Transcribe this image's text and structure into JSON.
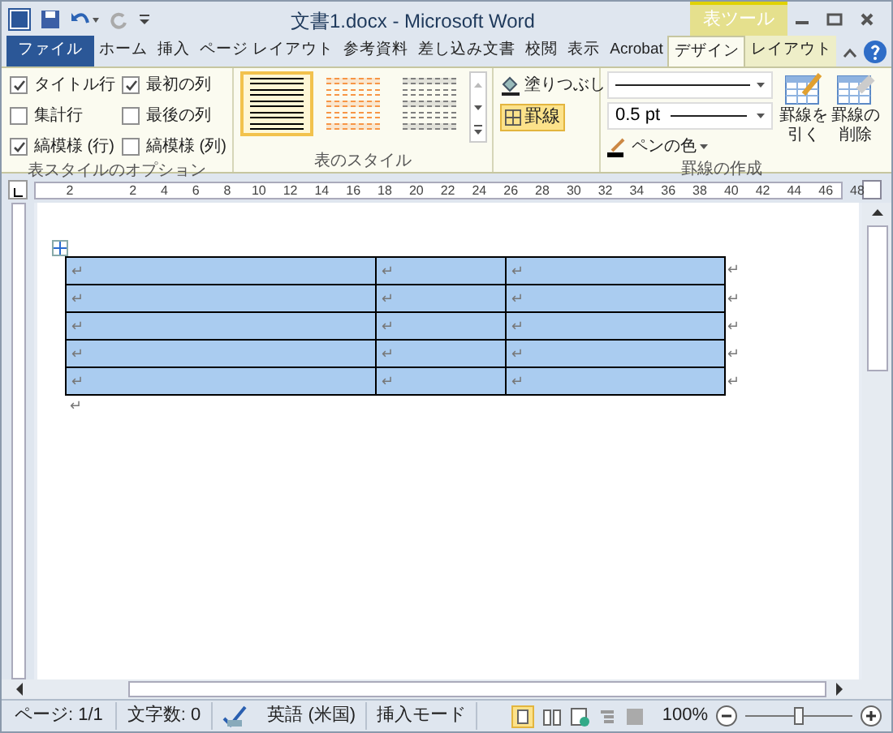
{
  "title_bar": {
    "title": "文書1.docx - Microsoft Word",
    "context_label": "表ツール"
  },
  "tabs": [
    {
      "label": "ファイル",
      "kind": "file",
      "selected": false
    },
    {
      "label": "ホーム",
      "kind": "normal",
      "selected": false
    },
    {
      "label": "挿入",
      "kind": "normal",
      "selected": false
    },
    {
      "label": "ページ レイアウト",
      "kind": "normal",
      "selected": false
    },
    {
      "label": "参考資料",
      "kind": "normal",
      "selected": false
    },
    {
      "label": "差し込み文書",
      "kind": "normal",
      "selected": false
    },
    {
      "label": "校閲",
      "kind": "normal",
      "selected": false
    },
    {
      "label": "表示",
      "kind": "normal",
      "selected": false
    },
    {
      "label": "Acrobat",
      "kind": "normal",
      "selected": false
    },
    {
      "label": "デザイン",
      "kind": "context",
      "selected": true
    },
    {
      "label": "レイアウト",
      "kind": "context",
      "selected": false
    }
  ],
  "style_options": {
    "title": "表スタイルのオプション",
    "options": [
      {
        "label": "タイトル行",
        "checked": true
      },
      {
        "label": "集計行",
        "checked": false
      },
      {
        "label": "縞模様 (行)",
        "checked": true
      },
      {
        "label": "最初の列",
        "checked": true
      },
      {
        "label": "最後の列",
        "checked": false
      },
      {
        "label": "縞模様 (列)",
        "checked": false
      }
    ]
  },
  "table_styles": {
    "title": "表のスタイル",
    "styles": [
      {
        "selected": true,
        "color": "#000000"
      },
      {
        "selected": false,
        "color": "#f79646"
      },
      {
        "selected": false,
        "color": "#7f7f7f"
      }
    ]
  },
  "shading": {
    "label": "塗りつぶし"
  },
  "borders": {
    "label": "罫線",
    "selected": true
  },
  "draw_borders": {
    "title": "罫線の作成",
    "line_weight": "0.5 pt",
    "pen_color": "ペンの色",
    "buttons": [
      {
        "label": "罫線を引く",
        "kind": "draw"
      },
      {
        "label": "罫線の削除",
        "kind": "erase"
      }
    ]
  },
  "ruler": {
    "ticks": [
      "2",
      "2",
      "4",
      "6",
      "8",
      "10",
      "12",
      "14",
      "16",
      "18",
      "20",
      "22",
      "24",
      "26",
      "28",
      "30",
      "32",
      "34",
      "36",
      "38",
      "40",
      "42",
      "44",
      "46",
      "48"
    ]
  },
  "table": {
    "selected": true,
    "rows": [
      {
        "cells": [
          "↵",
          "↵",
          "↵"
        ],
        "end_mark": "↵"
      },
      {
        "cells": [
          "↵",
          "↵",
          "↵"
        ],
        "end_mark": "↵"
      },
      {
        "cells": [
          "↵",
          "↵",
          "↵"
        ],
        "end_mark": "↵"
      },
      {
        "cells": [
          "↵",
          "↵",
          "↵"
        ],
        "end_mark": "↵"
      },
      {
        "cells": [
          "↵",
          "↵",
          "↵"
        ],
        "end_mark": "↵"
      }
    ],
    "after_mark": "↵"
  },
  "status_bar": {
    "page": "ページ: 1/1",
    "words": "文字数: 0",
    "language": "英語 (米国)",
    "mode": "挿入モード",
    "zoom": "100%",
    "zoom_slider": {
      "level": 0.5
    }
  }
}
